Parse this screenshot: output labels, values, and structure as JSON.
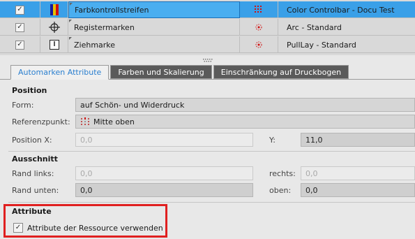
{
  "marks": [
    {
      "checked": true,
      "icon": "color-bar-icon",
      "name": "Farbkontrollstreifen",
      "preview": "grid-dots-icon",
      "resource": "Color Controlbar - Docu Test",
      "selected": true
    },
    {
      "checked": true,
      "icon": "crosshair-icon",
      "name": "Registermarken",
      "preview": "red-dot-icon",
      "resource": "Arc - Standard",
      "selected": false
    },
    {
      "checked": true,
      "icon": "pull-lay-icon",
      "name": "Ziehmarke",
      "preview": "red-dot-icon",
      "resource": "PullLay - Standard",
      "selected": false
    }
  ],
  "tabs": [
    {
      "label": "Automarken Attribute",
      "active": true
    },
    {
      "label": "Farben und Skalierung",
      "active": false
    },
    {
      "label": "Einschränkung auf Druckbogen",
      "active": false
    }
  ],
  "position": {
    "heading": "Position",
    "form_label": "Form:",
    "form_value": "auf Schön- und Widerdruck",
    "ref_label": "Referenzpunkt:",
    "ref_value": "Mitte oben",
    "x_label": "Position X:",
    "x_value": "0,0",
    "y_label": "Y:",
    "y_value": "11,0"
  },
  "cutout": {
    "heading": "Ausschnitt",
    "left_label": "Rand links:",
    "left_value": "0,0",
    "right_label": "rechts:",
    "right_value": "0,0",
    "bottom_label": "Rand unten:",
    "bottom_value": "0,0",
    "top_label": "oben:",
    "top_value": "0,0"
  },
  "attributes": {
    "heading": "Attribute",
    "checkbox_label": "Attribute der Ressource verwenden",
    "checked": true
  },
  "colors": {
    "selection": "#3aa0e8",
    "active_tab_text": "#2a7fcf",
    "highlight_box": "#e02020"
  }
}
